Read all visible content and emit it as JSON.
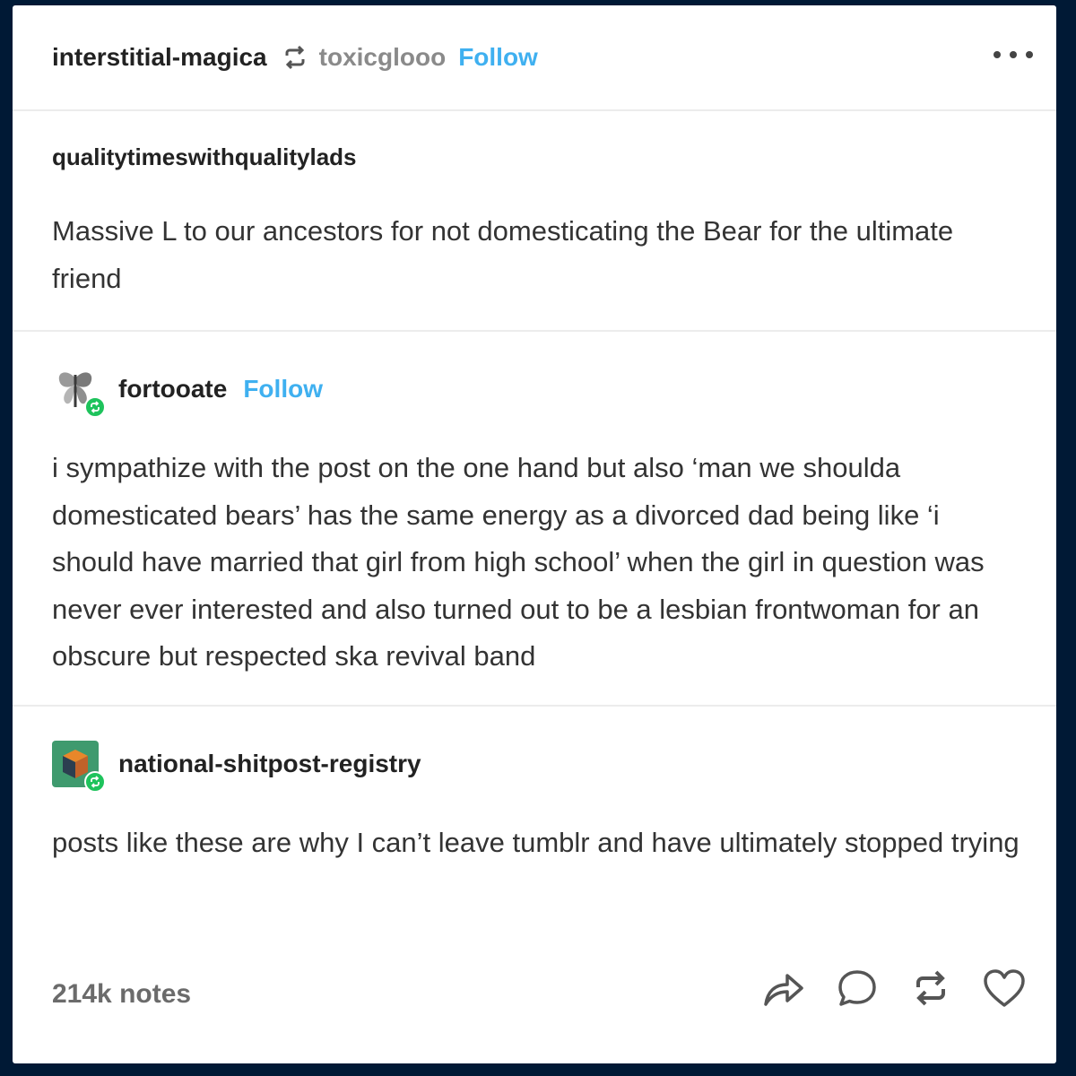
{
  "header": {
    "blog_name": "interstitial-magica",
    "source_name": "toxicglooo",
    "follow_label": "Follow"
  },
  "op": {
    "name": "qualitytimeswithqualitylads",
    "text": "Massive L to our ancestors for not domesticating the Bear for the ultimate friend"
  },
  "reply1": {
    "name": "fortooate",
    "follow_label": "Follow",
    "text": "i sympathize with the post on the one hand but also ‘man we shoulda domesticated bears’ has the same energy as a divorced dad being like ‘i should have married that girl from high school’ when the girl in question was never ever interested and also turned out to be a lesbian frontwoman for an obscure but respected ska revival band"
  },
  "reply2": {
    "name": "national-shitpost-registry",
    "text": "posts like these are why I can’t leave tumblr and have ultimately stopped trying"
  },
  "footer": {
    "notes": "214k notes",
    "actions": [
      "share-icon",
      "reply-icon",
      "reblog-icon",
      "like-icon"
    ]
  },
  "colors": {
    "background": "#001935",
    "follow": "#3fb0f0",
    "badge": "#1ec35c"
  }
}
